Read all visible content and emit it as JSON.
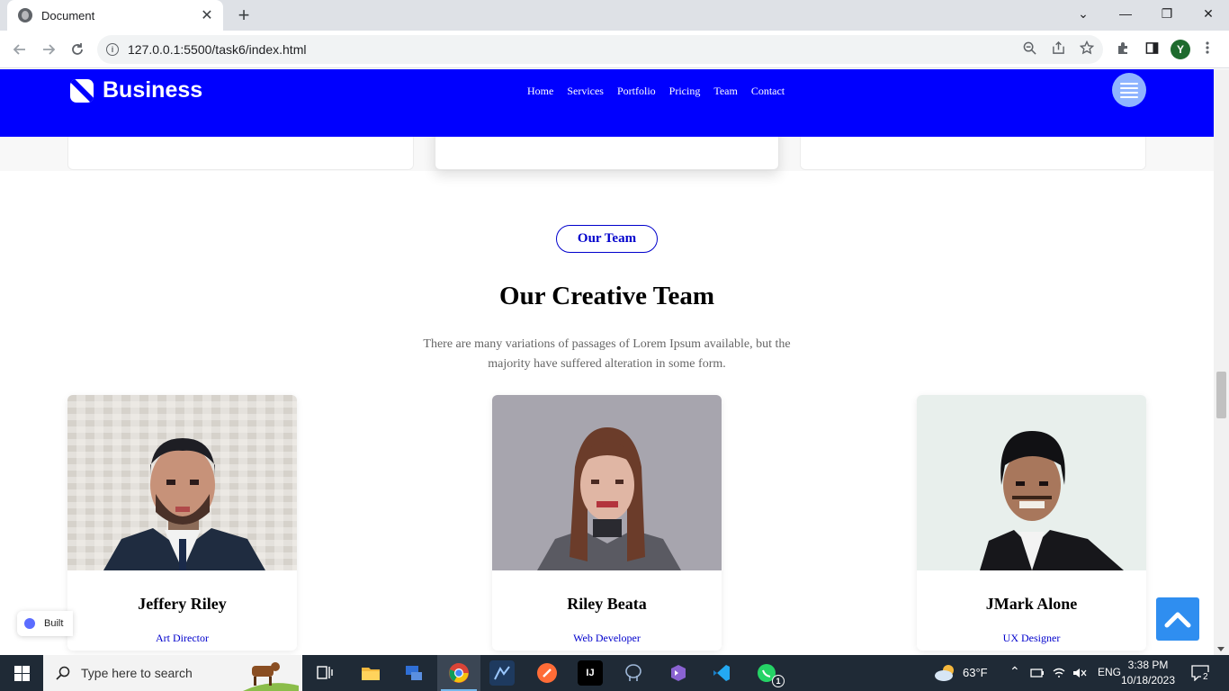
{
  "browser": {
    "tab_title": "Document",
    "tab_close": "✕",
    "new_tab": "+",
    "url": "127.0.0.1:5500/task6/index.html",
    "profile_initial": "Y",
    "window_controls": [
      "⌄",
      "—",
      "❐",
      "✕"
    ]
  },
  "header": {
    "logo_text": "Business",
    "menu": [
      "Home",
      "Services",
      "Portfolio",
      "Pricing",
      "Team",
      "Contact"
    ]
  },
  "team_section": {
    "pill_label": "Our Team",
    "title": "Our Creative Team",
    "description": "There are many variations of passages of Lorem Ipsum available, but the majority have suffered alteration in some form.",
    "members": [
      {
        "name": "Jeffery Riley",
        "role": "Art Director"
      },
      {
        "name": "Riley Beata",
        "role": "Web Developer"
      },
      {
        "name": "JMark Alone",
        "role": "UX Designer"
      }
    ]
  },
  "widgets": {
    "built_chip": "Built"
  },
  "taskbar": {
    "search_placeholder": "Type here to search",
    "weather": "63°F",
    "language": "ENG",
    "time": "3:38 PM",
    "date": "10/18/2023",
    "notification_count": "2",
    "whatsapp_badge": "1"
  },
  "colors": {
    "header_bg": "#0000ff",
    "accent": "#0000cc",
    "scroll_top_button": "#2f8ef0",
    "taskbar_bg": "#1f2a36"
  }
}
